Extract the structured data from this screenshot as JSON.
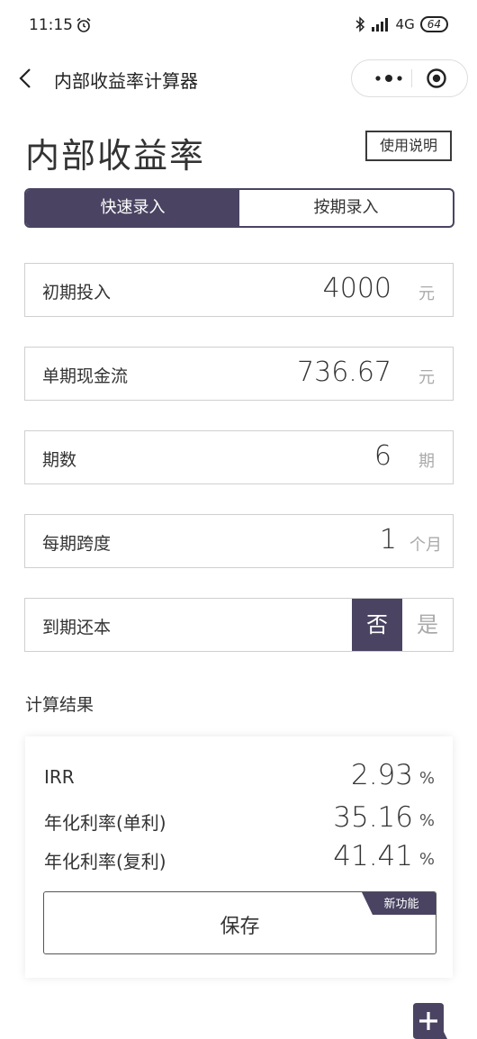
{
  "status_bar": {
    "time": "11:15",
    "network": "4G",
    "battery": "64"
  },
  "nav": {
    "title": "内部收益率计算器"
  },
  "page": {
    "title": "内部收益率",
    "help_label": "使用说明"
  },
  "tabs": [
    {
      "label": "快速录入",
      "active": true
    },
    {
      "label": "按期录入",
      "active": false
    }
  ],
  "fields": {
    "initial": {
      "label": "初期投入",
      "value": "4000",
      "unit": "元"
    },
    "cashflow": {
      "label": "单期现金流",
      "value": "736.67",
      "unit": "元"
    },
    "periods": {
      "label": "期数",
      "value": "6",
      "unit": "期"
    },
    "span": {
      "label": "每期跨度",
      "value": "1",
      "unit": "个月"
    },
    "principal": {
      "label": "到期还本",
      "option_no": "否",
      "option_yes": "是",
      "selected": "否"
    }
  },
  "results": {
    "heading": "计算结果",
    "rows": [
      {
        "label": "IRR",
        "value": "2.93",
        "unit": "%"
      },
      {
        "label": "年化利率(单利)",
        "value": "35.16",
        "unit": "%"
      },
      {
        "label": "年化利率(复利)",
        "value": "41.41",
        "unit": "%"
      }
    ],
    "save_label": "保存",
    "new_badge": "新功能"
  },
  "colors": {
    "accent": "#4a4462"
  },
  "icons": [
    "alarm-icon",
    "bluetooth-icon",
    "signal-icon",
    "back-icon",
    "more-icon",
    "target-icon",
    "add-icon"
  ]
}
